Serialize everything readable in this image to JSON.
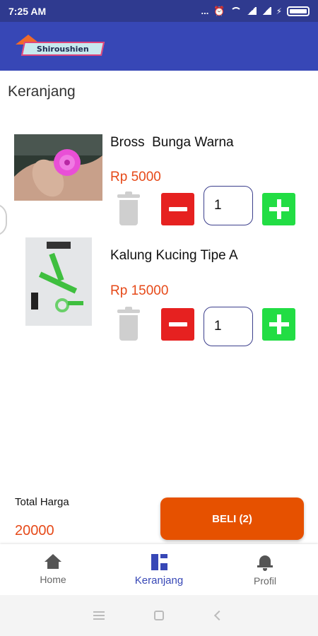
{
  "status_bar": {
    "time": "7:25 AM",
    "dots": "..."
  },
  "app_bar": {
    "logo_text": "Shiroushien"
  },
  "page": {
    "title": "Keranjang"
  },
  "cart": {
    "items": [
      {
        "name": "Bross  Bunga Warna",
        "price": "Rp 5000",
        "quantity": "1"
      },
      {
        "name": "Kalung Kucing Tipe A",
        "price": "Rp 15000",
        "quantity": "1"
      }
    ]
  },
  "summary": {
    "total_label": "Total Harga",
    "total_value": "20000",
    "buy_label": "BELI (2)"
  },
  "bottom_nav": {
    "items": [
      {
        "label": "Home",
        "icon": "home-icon"
      },
      {
        "label": "Keranjang",
        "icon": "dashboard-icon",
        "active": true
      },
      {
        "label": "Profil",
        "icon": "bell-icon"
      }
    ]
  },
  "colors": {
    "primary": "#3747b6",
    "price": "#e64a19",
    "minus": "#e62120",
    "plus": "#22dd44",
    "buy": "#e65100"
  }
}
